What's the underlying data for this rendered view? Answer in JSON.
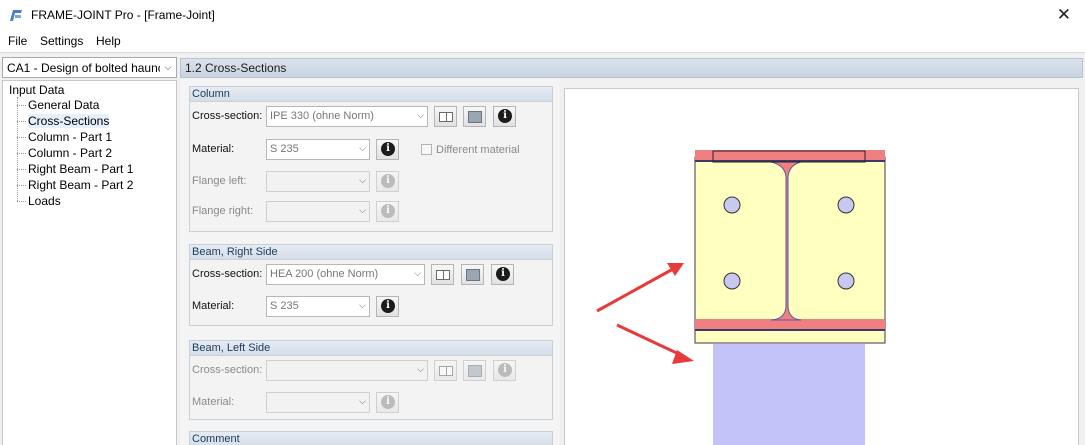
{
  "window": {
    "title": "FRAME-JOINT Pro - [Frame-Joint]",
    "close_symbol": "✕",
    "app_icon": "frame-joint-app-icon"
  },
  "menu": {
    "items": [
      "File",
      "Settings",
      "Help"
    ]
  },
  "navigator": {
    "case_value": "CA1 - Design of bolted haunche",
    "root_label": "Input Data",
    "items": [
      "General Data",
      "Cross-Sections",
      "Column - Part 1",
      "Column - Part 2",
      "Right Beam - Part 1",
      "Right Beam - Part 2",
      "Loads"
    ],
    "selected": "Cross-Sections"
  },
  "section": {
    "title": "1.2 Cross-Sections"
  },
  "column": {
    "title": "Column",
    "cross_section_label": "Cross-section:",
    "cross_section_value": "IPE 330 (ohne Norm)",
    "material_label": "Material:",
    "material_value": "S 235",
    "different_material_label": "Different material",
    "flange_left_label": "Flange left:",
    "flange_right_label": "Flange right:"
  },
  "beam_right": {
    "title": "Beam, Right Side",
    "cross_section_label": "Cross-section:",
    "cross_section_value": "HEA 200 (ohne Norm)",
    "material_label": "Material:",
    "material_value": "S 235"
  },
  "beam_left": {
    "title": "Beam, Left Side",
    "cross_section_label": "Cross-section:",
    "material_label": "Material:"
  },
  "comment": {
    "title": "Comment"
  },
  "colors": {
    "flange": "#f08080",
    "web_plate": "#ffffc0",
    "beam": "#c3c3fa",
    "bolt": "#c8c8f0",
    "arrow": "#e8393b",
    "outline": "#3a3a6a"
  },
  "icons": [
    "book-icon",
    "library-icon",
    "info-icon",
    "chevron-down-icon"
  ]
}
